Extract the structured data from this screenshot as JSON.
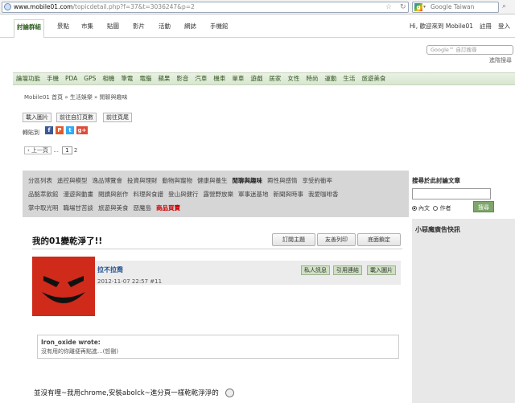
{
  "browser": {
    "url_host": "www.mobile01.com",
    "url_path": "/topicdetail.php?f=37&t=3036247&p=2",
    "search_engine_label": "Google Taiwan"
  },
  "topnav": {
    "tabs": [
      "討論群組",
      "景點",
      "市集",
      "貼圖",
      "影片",
      "活動",
      "網誌",
      "手機館"
    ],
    "greeting": "Hi, 歡迎來到 Mobile01",
    "register": "註冊",
    "login": "登入"
  },
  "site_search": {
    "placeholder": "Google™ 自訂搜尋",
    "advanced": "進階搜尋"
  },
  "categories": [
    "論壇功能",
    "手機",
    "PDA",
    "GPS",
    "相機",
    "筆電",
    "電腦",
    "蘋果",
    "影音",
    "汽車",
    "機車",
    "單車",
    "遊戲",
    "居家",
    "女性",
    "時尚",
    "運動",
    "生活",
    "旅遊美食"
  ],
  "breadcrumb": "Mobile01 首頁 » 生活娛樂 » 閒聊與趣味",
  "actions": {
    "load_images": "載入圖片",
    "goto_custom_page": "前往自訂頁數",
    "goto_last_page": "前往頁尾"
  },
  "share": {
    "label": "轉貼到"
  },
  "pager": {
    "prev": "‹ 上一頁",
    "ellipsis": "...",
    "current": "1",
    "next": "2"
  },
  "forums": {
    "row1": [
      "分區列表",
      "遙控與模型",
      "逸品博覽會",
      "投資與理財",
      "動物與寵物",
      "健康與養生",
      "閒聊與趣味",
      "兩性與感情",
      "享受約衝率"
    ],
    "row2": [
      "品酩萃飲館",
      "漫遊與動畫",
      "閱讀與創作",
      "料理與食譜",
      "登山與健行",
      "露營野放樂",
      "軍事迷基地",
      "新聞與時事",
      "我愛咖啡香"
    ],
    "row3": [
      "掌中取光明",
      "職場甘苦談",
      "旅遊與美食",
      "惡魔島"
    ],
    "highlight": "商品買賣"
  },
  "sidebar": {
    "search_title": "搜尋於此討論文章",
    "option_content": "內文",
    "option_author": "作者",
    "search_button": "搜尋",
    "ad_title": "小惡魔廣告快訊"
  },
  "topic": {
    "title": "我的01變乾淨了!!",
    "subscribe": "訂閱主題",
    "print": "友善列印",
    "bottom": "底面鎖定"
  },
  "post": {
    "author": "拉不拉喬",
    "meta": "2012-11-07 22:57  #11",
    "private_msg": "私人訊息",
    "quote_link": "引用連結",
    "load_images": "載入圖片",
    "quote_author": "Iron_oxide wrote:",
    "quote_text": "沒有用的你離便再點進...(恕刪)",
    "body": "並沒有哩~我用chrome,安裝abolck~進分頁一樣乾乾淨淨的"
  }
}
